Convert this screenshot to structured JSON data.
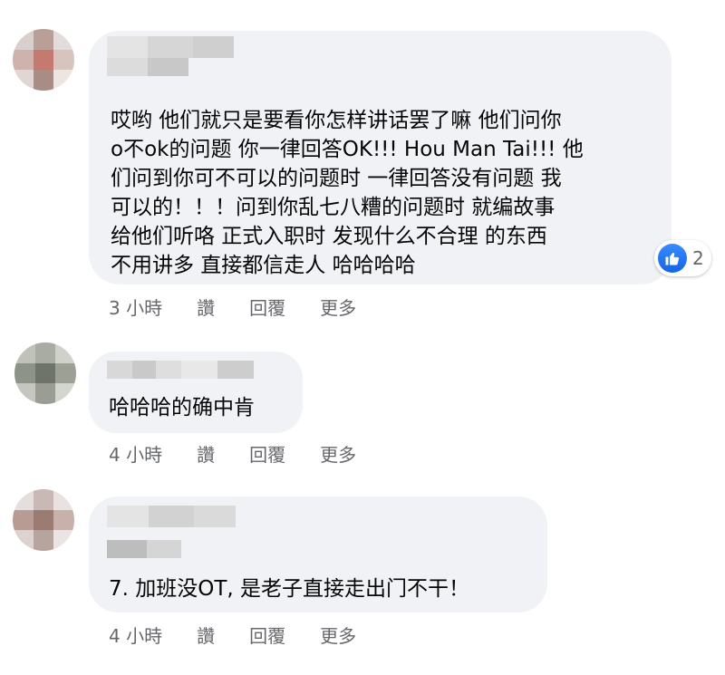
{
  "comments": [
    {
      "text": "哎哟 他们就只是要看你怎样讲话罢了嘛 他们问你\no不ok的问题 你一律回答OK!!! Hou Man Tai!!! 他\n们问到你可不可以的问题时 一律回答没有问题 我\n可以的！！！问到你乱七八糟的问题时 就编故事\n给他们听咯 正式入职时 发现什么不合理 的东西\n不用讲多 直接都信走人 哈哈哈哈",
      "time": "3 小時",
      "like": "讚",
      "reply": "回覆",
      "more": "更多",
      "reaction_count": "2"
    },
    {
      "text": "哈哈哈的确中肯",
      "time": "4 小時",
      "like": "讚",
      "reply": "回覆",
      "more": "更多"
    },
    {
      "text": "7. 加班没OT, 是老子直接走出门不干！",
      "time": "4 小時",
      "like": "讚",
      "reply": "回覆",
      "more": "更多"
    }
  ],
  "colors": {
    "bubble": "#f0f2f5",
    "meta_text": "#65676b",
    "like_blue": "#1877f2"
  },
  "icons": [
    "like-thumb-icon"
  ]
}
